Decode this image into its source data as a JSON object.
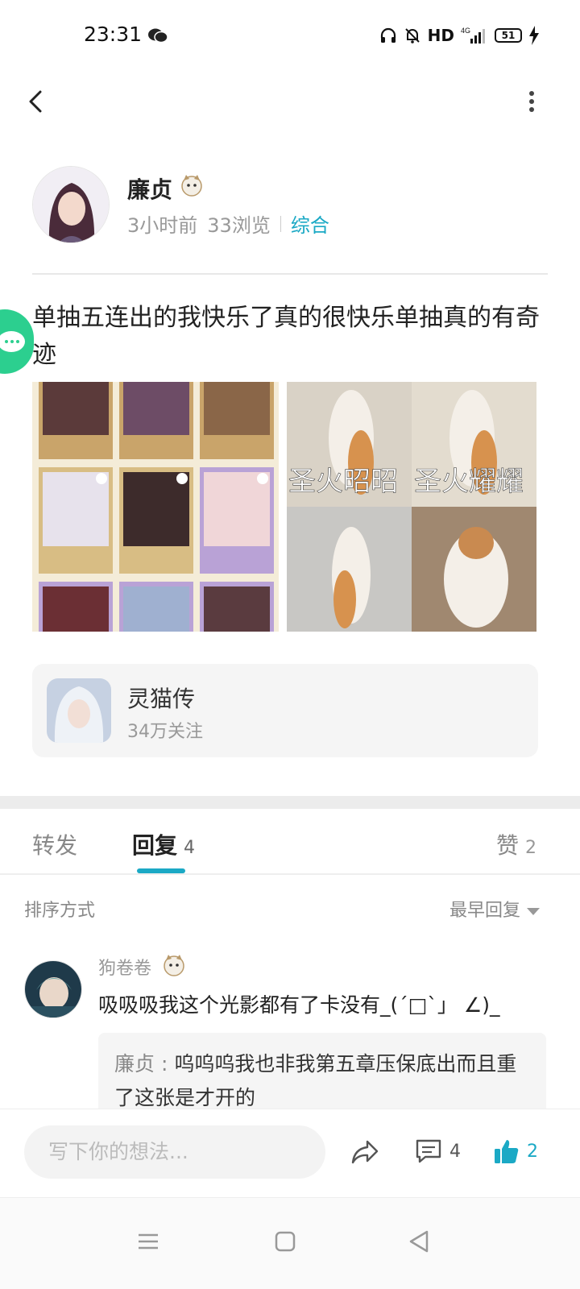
{
  "status_bar": {
    "time": "23:31",
    "hd": "HD",
    "network": "4G",
    "battery": "51"
  },
  "author": {
    "name": "廉贞",
    "time_ago": "3小时前",
    "views": "33浏览",
    "category": "综合"
  },
  "post": {
    "text": "单抽五连出的我快乐了真的很快乐单抽真的有奇迹",
    "image_right_captions": [
      "圣火昭昭",
      "圣火耀耀"
    ]
  },
  "game": {
    "name": "灵猫传",
    "followers": "34万关注"
  },
  "tabs": {
    "forward_label": "转发",
    "reply_label": "回复",
    "reply_count": "4",
    "like_label": "赞",
    "like_count": "2"
  },
  "sort": {
    "label": "排序方式",
    "value": "最早回复"
  },
  "comment": {
    "user": "狗卷卷",
    "text": "吸吸吸我这个光影都有了卡没有_(´□`」 ∠)_",
    "reply_user": "廉贞",
    "reply_sep": " : ",
    "reply_text": "呜呜呜我也非我第五章压保底出而且重了这张是才开的"
  },
  "bottom_bar": {
    "input_placeholder": "写下你的想法...",
    "comment_count": "4",
    "like_count": "2"
  },
  "colors": {
    "accent": "#1ba9c5",
    "text_primary": "#222222",
    "text_secondary": "#999999"
  }
}
